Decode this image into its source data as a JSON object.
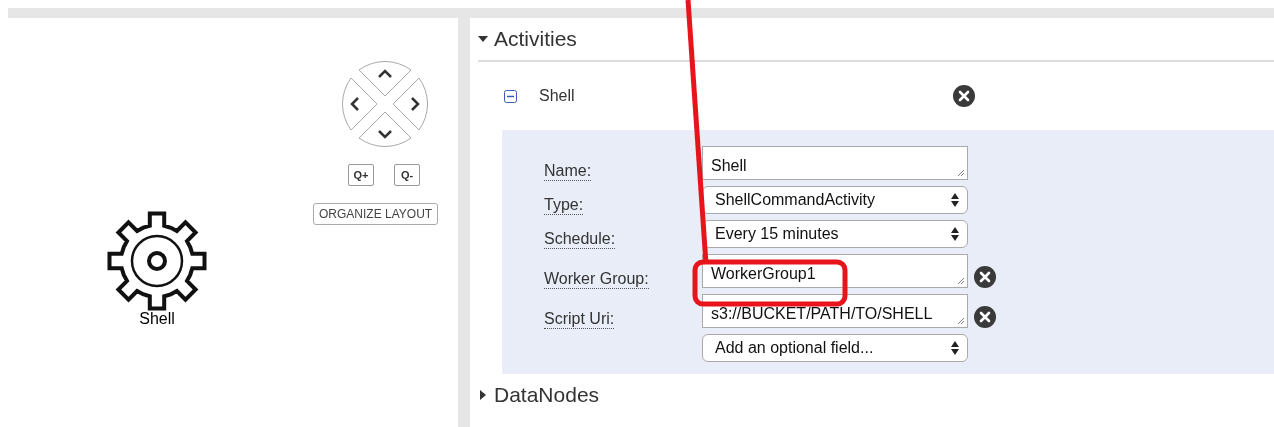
{
  "canvas": {
    "node": {
      "label": "Shell"
    },
    "zoom_in": {
      "label": "Q+"
    },
    "zoom_out": {
      "label": "Q-"
    },
    "organize_button": "ORGANIZE LAYOUT"
  },
  "sections": [
    {
      "title": "Activities",
      "expanded": true,
      "items": [
        {
          "name": "Shell",
          "expanded": true,
          "fields": [
            {
              "label": "Name:",
              "kind": "text",
              "value": "Shell",
              "removable": false
            },
            {
              "label": "Type:",
              "kind": "select",
              "value": "ShellCommandActivity",
              "removable": false
            },
            {
              "label": "Schedule:",
              "kind": "select",
              "value": "Every 15 minutes",
              "removable": false
            },
            {
              "label": "Worker Group:",
              "kind": "text",
              "value": "WorkerGroup1",
              "removable": true,
              "highlighted": true
            },
            {
              "label": "Script Uri:",
              "kind": "text",
              "value": "s3://BUCKET/PATH/TO/SHELL",
              "removable": true
            },
            {
              "kind": "select",
              "value": "Add an optional field...",
              "removable": false
            }
          ]
        }
      ]
    },
    {
      "title": "DataNodes",
      "expanded": false
    }
  ]
}
